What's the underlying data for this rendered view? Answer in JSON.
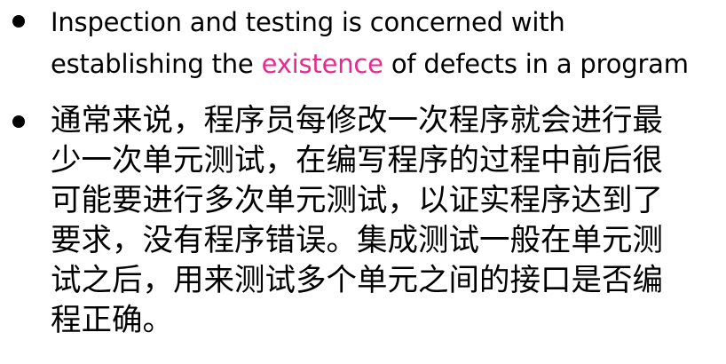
{
  "slide": {
    "bullets": [
      {
        "lines": [
          [
            {
              "text": "Inspection and testing is concerned with",
              "highlight": false
            }
          ],
          [
            {
              "text": "establishing the ",
              "highlight": false
            },
            {
              "text": "existence",
              "highlight": true
            },
            {
              "text": " of defects in a program",
              "highlight": false
            }
          ]
        ]
      },
      {
        "lines": [
          [
            {
              "text": "通常来说，程序员每修改一次程序就会进行最",
              "highlight": false
            }
          ],
          [
            {
              "text": "少一次单元测试，在编写程序的过程中前后很",
              "highlight": false
            }
          ],
          [
            {
              "text": "可能要进行多次单元测试，以证实程序达到了",
              "highlight": false
            }
          ],
          [
            {
              "text": "要求，没有程序错误。集成测试一般在单元测",
              "highlight": false
            }
          ],
          [
            {
              "text": "试之后，用来测试多个单元之间的接口是否编",
              "highlight": false
            }
          ],
          [
            {
              "text": "程正确。",
              "highlight": false
            }
          ]
        ]
      }
    ]
  },
  "colors": {
    "text": "#000000",
    "highlight": "#e8298f",
    "background": "#ffffff"
  }
}
